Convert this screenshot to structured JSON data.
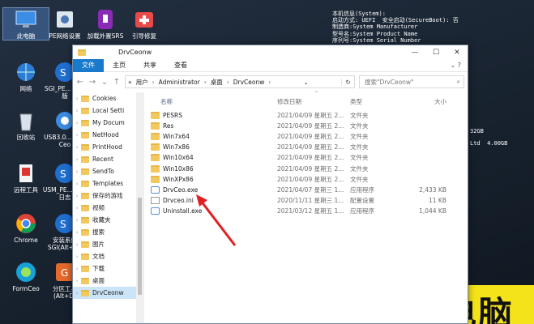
{
  "desktop_icons": [
    {
      "label": "此电脑",
      "icon": "computer-icon",
      "selected": true
    },
    {
      "label": "PE网络设置",
      "icon": "network-settings-icon"
    },
    {
      "label": "加载外置SRS",
      "icon": "usb-plug-icon"
    },
    {
      "label": "引导修复",
      "icon": "first-aid-icon"
    },
    {
      "label": "网络",
      "icon": "network-icon"
    },
    {
      "label": "SGI_PE... 测试版",
      "icon": "sgi-globe-icon"
    },
    {
      "label": "回收站",
      "icon": "recycle-bin-icon"
    },
    {
      "label": "USB3.0... 工具Ceo",
      "icon": "gear-icon"
    },
    {
      "label": "远程工具",
      "icon": "remote-tool-icon"
    },
    {
      "label": "USM_PE... 安装日志",
      "icon": "sgi-globe-icon"
    },
    {
      "label": "Chrome",
      "icon": "chrome-icon"
    },
    {
      "label": "安装系统 SGI(Alt+...)",
      "icon": "sgi-globe-icon"
    },
    {
      "label": "FormCeo",
      "icon": "formceo-icon"
    },
    {
      "label": "分区工具 (Alt+D)",
      "icon": "partition-icon"
    }
  ],
  "sysinfo_lines": [
    "本机信息(System):",
    "启动方式: UEFI  安全启动(SecureBoot): 否",
    "制造商:System Manufacturer",
    "型号名:System Product Name",
    "序列号:System Serial Number"
  ],
  "sysinfo_right": [
    "32GB",
    "Ltd  4.00GB"
  ],
  "brand_text": "电脑",
  "window": {
    "title": "DrvCeonw",
    "ribbon_tabs": [
      "文件",
      "主页",
      "共享",
      "查看"
    ],
    "path": [
      "用户",
      "Administrator",
      "桌面",
      "DrvCeonw"
    ],
    "search_placeholder": "搜索\"DrvCeonw\"",
    "nav_items": [
      {
        "label": "Cookies"
      },
      {
        "label": "Local Setti"
      },
      {
        "label": "My Docum"
      },
      {
        "label": "NetHood"
      },
      {
        "label": "PrintHood"
      },
      {
        "label": "Recent"
      },
      {
        "label": "SendTo"
      },
      {
        "label": "Templates"
      },
      {
        "label": "保存的游戏"
      },
      {
        "label": "视频"
      },
      {
        "label": "收藏夹"
      },
      {
        "label": "搜索"
      },
      {
        "label": "图片"
      },
      {
        "label": "文档"
      },
      {
        "label": "下载"
      },
      {
        "label": "桌面"
      },
      {
        "label": "DrvCeonw",
        "selected": true
      }
    ],
    "columns": {
      "name": "名称",
      "date": "修改日期",
      "type": "类型",
      "size": "大小"
    },
    "files": [
      {
        "name": "PESRS",
        "date": "2021/04/09 星期五 2...",
        "type": "文件夹",
        "size": "",
        "kind": "folder"
      },
      {
        "name": "Res",
        "date": "2021/04/09 星期五 2...",
        "type": "文件夹",
        "size": "",
        "kind": "folder"
      },
      {
        "name": "Win7x64",
        "date": "2021/04/09 星期五 2...",
        "type": "文件夹",
        "size": "",
        "kind": "folder"
      },
      {
        "name": "Win7x86",
        "date": "2021/04/09 星期五 2...",
        "type": "文件夹",
        "size": "",
        "kind": "folder"
      },
      {
        "name": "Win10x64",
        "date": "2021/04/09 星期五 2...",
        "type": "文件夹",
        "size": "",
        "kind": "folder"
      },
      {
        "name": "Win10x86",
        "date": "2021/04/09 星期五 2...",
        "type": "文件夹",
        "size": "",
        "kind": "folder"
      },
      {
        "name": "WinXPx86",
        "date": "2021/04/09 星期五 2...",
        "type": "文件夹",
        "size": "",
        "kind": "folder"
      },
      {
        "name": "DrvCeo.exe",
        "date": "2021/04/07 星期三 1...",
        "type": "应用程序",
        "size": "2,433 KB",
        "kind": "exe"
      },
      {
        "name": "Drvceo.ini",
        "date": "2020/11/11 星期三 1...",
        "type": "配置设置",
        "size": "11 KB",
        "kind": "ini"
      },
      {
        "name": "Uninstall.exe",
        "date": "2021/03/12 星期五 1...",
        "type": "应用程序",
        "size": "1,044 KB",
        "kind": "exe"
      }
    ]
  },
  "colors": {
    "accent": "#1979ca",
    "arrow": "#e02020",
    "brand_bg": "#f5e31a"
  }
}
